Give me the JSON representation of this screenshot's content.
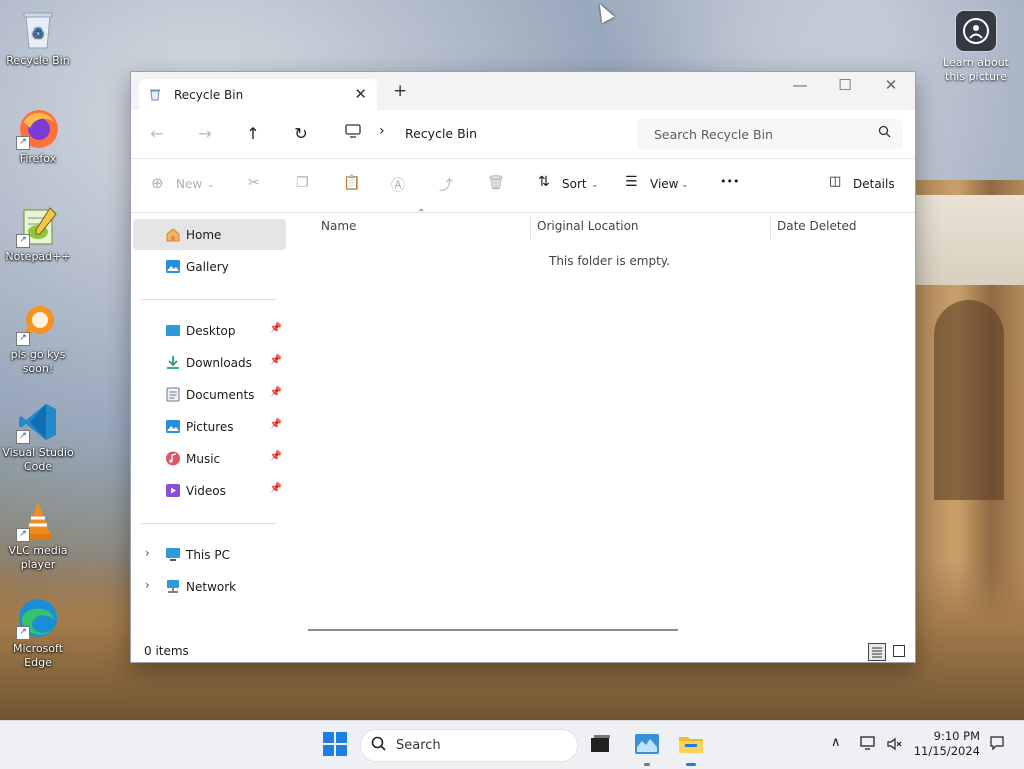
{
  "desktop": {
    "icons": [
      {
        "label": "Recycle Bin"
      },
      {
        "label": "Firefox"
      },
      {
        "label": "Notepad++"
      },
      {
        "label": "pls go kys soon!"
      },
      {
        "label": "Visual Studio Code"
      },
      {
        "label": "VLC media player"
      },
      {
        "label": "Microsoft Edge"
      }
    ],
    "learn_label": "Learn about this picture"
  },
  "window": {
    "tab_title": "Recycle Bin",
    "new_tab_symbol": "+",
    "controls": {
      "minimize": "—",
      "maximize": "☐",
      "close": "✕"
    },
    "address": {
      "crumb": "Recycle Bin",
      "separator": "›"
    },
    "search": {
      "placeholder": "Search Recycle Bin"
    },
    "commands": {
      "new": "New",
      "sort": "Sort",
      "view": "View",
      "more": "•••",
      "details": "Details"
    },
    "sidebar": {
      "home": "Home",
      "gallery": "Gallery",
      "pinned": [
        {
          "label": "Desktop",
          "color": "#2e9bd8"
        },
        {
          "label": "Downloads",
          "color": "#1aa37a"
        },
        {
          "label": "Documents",
          "color": "#6c7a8c"
        },
        {
          "label": "Pictures",
          "color": "#2b8de0"
        },
        {
          "label": "Music",
          "color": "#e0566b"
        },
        {
          "label": "Videos",
          "color": "#8a4fd6"
        }
      ],
      "this_pc": "This PC",
      "network": "Network"
    },
    "columns": {
      "name": "Name",
      "original_location": "Original Location",
      "date_deleted": "Date Deleted"
    },
    "empty_message": "This folder is empty.",
    "status": {
      "item_count": "0 items"
    }
  },
  "taskbar": {
    "search_label": "Search",
    "clock": {
      "time": "9:10 PM",
      "date": "11/15/2024"
    }
  }
}
